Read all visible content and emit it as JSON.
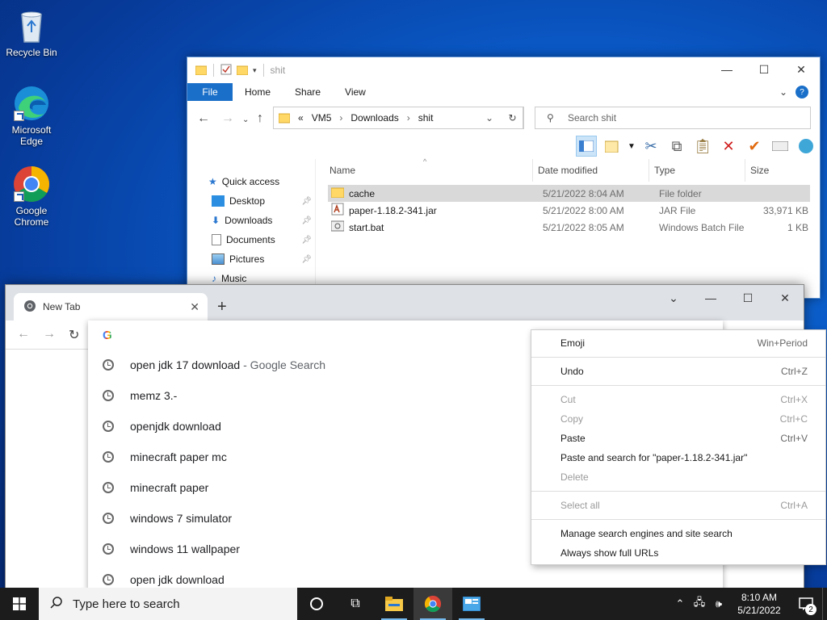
{
  "desktop": {
    "icons": [
      {
        "label": "Recycle Bin"
      },
      {
        "label": "Microsoft Edge"
      },
      {
        "label": "Google Chrome"
      }
    ]
  },
  "explorer": {
    "title": "shit",
    "ribbon_tabs": [
      "File",
      "Home",
      "Share",
      "View"
    ],
    "breadcrumb": [
      "VM5",
      "Downloads",
      "shit"
    ],
    "breadcrumb_prefix": "«",
    "search_placeholder": "Search shit",
    "nav_items": [
      {
        "label": "Quick access"
      },
      {
        "label": "Desktop"
      },
      {
        "label": "Downloads"
      },
      {
        "label": "Documents"
      },
      {
        "label": "Pictures"
      },
      {
        "label": "Music"
      }
    ],
    "columns": [
      "Name",
      "Date modified",
      "Type",
      "Size"
    ],
    "files": [
      {
        "name": "cache",
        "date": "5/21/2022 8:04 AM",
        "type": "File folder",
        "size": ""
      },
      {
        "name": "paper-1.18.2-341.jar",
        "date": "5/21/2022 8:00 AM",
        "type": "JAR File",
        "size": "33,971 KB"
      },
      {
        "name": "start.bat",
        "date": "5/21/2022 8:05 AM",
        "type": "Windows Batch File",
        "size": "1 KB"
      }
    ]
  },
  "chrome": {
    "tab_title": "New Tab",
    "suggestions": [
      {
        "text": "open jdk 17 download",
        "suffix": "- Google Search"
      },
      {
        "text": "memz 3.-",
        "suffix": ""
      },
      {
        "text": "openjdk download",
        "suffix": ""
      },
      {
        "text": "minecraft paper mc",
        "suffix": ""
      },
      {
        "text": "minecraft paper",
        "suffix": ""
      },
      {
        "text": "windows 7 simulator",
        "suffix": ""
      },
      {
        "text": "windows 11 wallpaper",
        "suffix": ""
      },
      {
        "text": "open jdk download",
        "suffix": ""
      }
    ]
  },
  "context_menu": {
    "items": [
      {
        "label": "Emoji",
        "shortcut": "Win+Period",
        "disabled": false
      },
      {
        "label": "Undo",
        "shortcut": "Ctrl+Z",
        "disabled": false
      },
      {
        "label": "Cut",
        "shortcut": "Ctrl+X",
        "disabled": true
      },
      {
        "label": "Copy",
        "shortcut": "Ctrl+C",
        "disabled": true
      },
      {
        "label": "Paste",
        "shortcut": "Ctrl+V",
        "disabled": false
      },
      {
        "label": "Paste and search for \"paper-1.18.2-341.jar\"",
        "shortcut": "",
        "disabled": false
      },
      {
        "label": "Delete",
        "shortcut": "",
        "disabled": true
      },
      {
        "label": "Select all",
        "shortcut": "Ctrl+A",
        "disabled": true
      },
      {
        "label": "Manage search engines and site search",
        "shortcut": "",
        "disabled": false
      },
      {
        "label": "Always show full URLs",
        "shortcut": "",
        "disabled": false
      }
    ]
  },
  "taskbar": {
    "search_placeholder": "Type here to search",
    "time": "8:10 AM",
    "date": "5/21/2022",
    "notification_count": "2"
  },
  "colors": {
    "accent": "#1a6fc9",
    "selection": "#d9d9d9",
    "taskbar": "#1c1c1c"
  }
}
